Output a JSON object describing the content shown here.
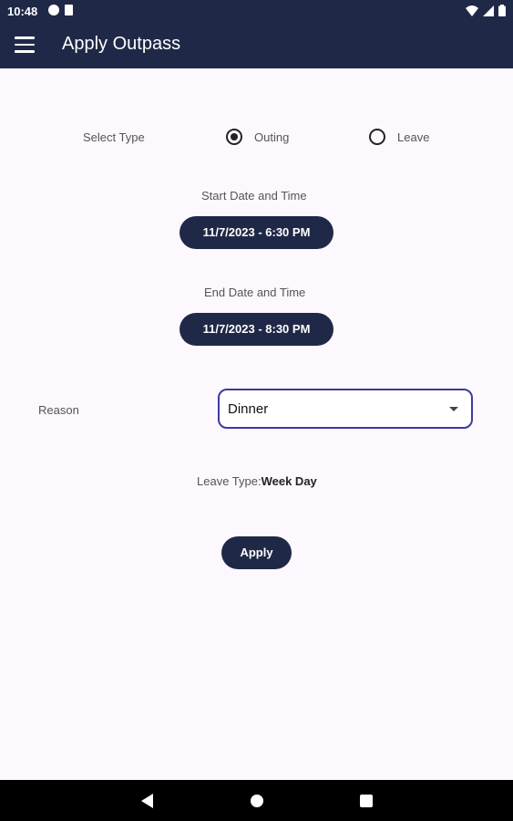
{
  "status_bar": {
    "time": "10:48",
    "icons": [
      "notification-icon",
      "sd-card-icon",
      "wifi-icon",
      "signal-icon",
      "battery-icon"
    ]
  },
  "app_bar": {
    "title": "Apply Outpass"
  },
  "form": {
    "select_type_label": "Select Type",
    "type_options": [
      {
        "label": "Outing",
        "selected": true
      },
      {
        "label": "Leave",
        "selected": false
      }
    ],
    "start_label": "Start Date and Time",
    "start_value": "11/7/2023 - 6:30 PM",
    "end_label": "End Date and Time",
    "end_value": "11/7/2023 - 8:30 PM",
    "reason_label": "Reason",
    "reason_value": "Dinner",
    "leave_type_label": "Leave Type:",
    "leave_type_value": "Week Day",
    "apply_label": "Apply"
  },
  "colors": {
    "primary": "#1f2947",
    "background": "#fdf8fd",
    "select_border": "#3f3a9e"
  }
}
